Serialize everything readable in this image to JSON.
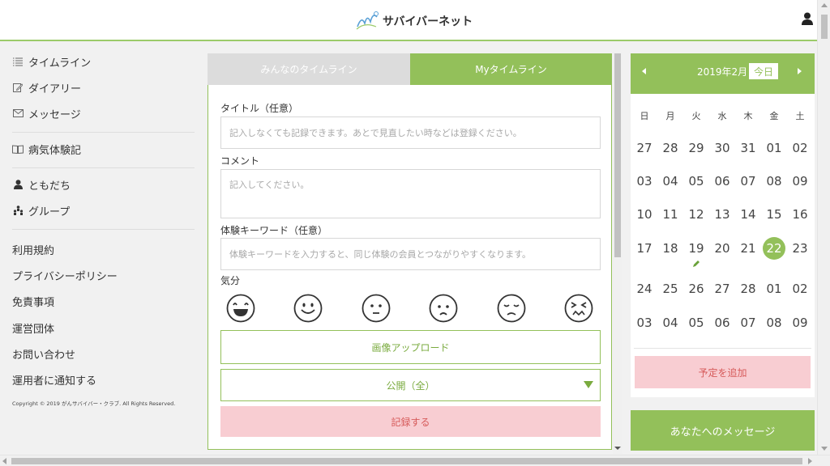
{
  "header": {
    "logo_text": "サバイバーネット",
    "logo_mark": "surviver-logo-icon",
    "user_icon": "user-icon",
    "accent": "#93c05a"
  },
  "sidebar": {
    "group1": [
      {
        "label": "タイムライン",
        "icon": "list-icon"
      },
      {
        "label": "ダイアリー",
        "icon": "edit-icon"
      },
      {
        "label": "メッセージ",
        "icon": "mail-icon"
      }
    ],
    "group2": [
      {
        "label": "病気体験記",
        "icon": "book-icon"
      }
    ],
    "group3": [
      {
        "label": "ともだち",
        "icon": "user-icon"
      },
      {
        "label": "グループ",
        "icon": "group-icon"
      }
    ],
    "links": [
      "利用規約",
      "プライバシーポリシー",
      "免責事項",
      "運営団体",
      "お問い合わせ",
      "運用者に通知する"
    ],
    "copyright": "Copyright © 2019 がんサバイバー・クラブ. All Rights Reserved."
  },
  "tabs": [
    {
      "label": "みんなのタイムライン",
      "active": false
    },
    {
      "label": "Myタイムライン",
      "active": true
    }
  ],
  "form": {
    "title_label": "タイトル（任意）",
    "title_placeholder": "記入しなくても記録できます。あとで見直したい時などは登録ください。",
    "comment_label": "コメント",
    "comment_placeholder": "記入してください。",
    "keyword_label": "体験キーワード（任意）",
    "keyword_placeholder": "体験キーワードを入力すると、同じ体験の会員とつながりやすくなります。",
    "mood_label": "気分",
    "moods": [
      "very-happy-face-icon",
      "happy-face-icon",
      "neutral-face-icon",
      "sad-face-icon",
      "tired-face-icon",
      "distressed-face-icon"
    ],
    "upload_label": "画像アップロード",
    "visibility_value": "公開（全）",
    "submit_label": "記録する"
  },
  "calendar": {
    "title": "2019年2月",
    "today_label": "今日",
    "weekdays": [
      "日",
      "月",
      "火",
      "水",
      "木",
      "金",
      "土"
    ],
    "weeks": [
      [
        "27",
        "28",
        "29",
        "30",
        "31",
        "01",
        "02"
      ],
      [
        "03",
        "04",
        "05",
        "06",
        "07",
        "08",
        "09"
      ],
      [
        "10",
        "11",
        "12",
        "13",
        "14",
        "15",
        "16"
      ],
      [
        "17",
        "18",
        "19",
        "20",
        "21",
        "22",
        "23"
      ],
      [
        "24",
        "25",
        "26",
        "27",
        "28",
        "01",
        "02"
      ],
      [
        "03",
        "04",
        "05",
        "06",
        "07",
        "08",
        "09"
      ]
    ],
    "today": "22",
    "marked_day": "19",
    "add_label": "予定を追加"
  },
  "messages": {
    "label": "あなたへのメッセージ"
  }
}
